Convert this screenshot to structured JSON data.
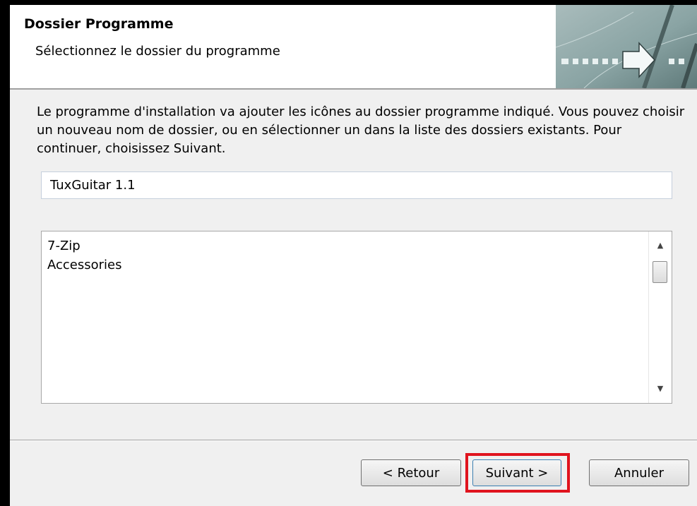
{
  "header": {
    "title": "Dossier Programme",
    "subtitle": "Sélectionnez le dossier du programme"
  },
  "description": "Le programme d'installation va ajouter les icônes au dossier programme indiqué. Vous pouvez choisir un nouveau nom de dossier, ou en sélectionner un dans la liste des dossiers existants. Pour continuer, choisissez Suivant.",
  "folder_input": {
    "value": "TuxGuitar 1.1"
  },
  "folder_list": {
    "items": [
      "7-Zip",
      "Accessories"
    ]
  },
  "buttons": {
    "back": "< Retour",
    "next": "Suivant >",
    "cancel": "Annuler"
  },
  "colors": {
    "highlight": "#e0141e",
    "header_graphic": "#8aa6a6"
  },
  "icons": {
    "scroll_up": "▲",
    "scroll_down": "▼"
  }
}
